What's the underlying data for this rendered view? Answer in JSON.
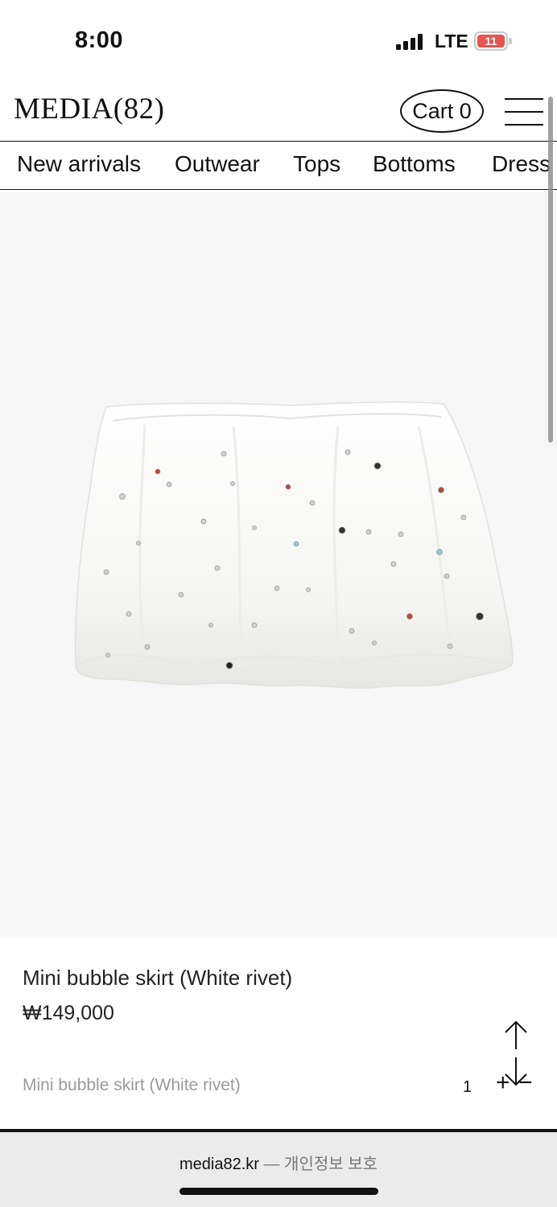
{
  "status_bar": {
    "time": "8:00",
    "network": "LTE",
    "battery": "11"
  },
  "header": {
    "logo": "MEDIA(82)",
    "cart_label": "Cart 0",
    "menu_icon": "hamburger-menu-icon"
  },
  "categories": [
    "New arrivals",
    "Outwear",
    "Tops",
    "Bottoms",
    "Dress"
  ],
  "product": {
    "name": "Mini bubble skirt (White rivet)",
    "price": "₩149,000"
  },
  "selection": {
    "option_label": "Mini bubble skirt (White rivet)",
    "quantity": "1",
    "plus": "+",
    "minus": "−"
  },
  "browser": {
    "domain": "media82.kr",
    "separator": "—",
    "privacy_note": "개인정보 보호"
  },
  "colors": {
    "accent": "#111111",
    "battery_low": "#e4564f",
    "image_bg": "#f6f6f6"
  }
}
